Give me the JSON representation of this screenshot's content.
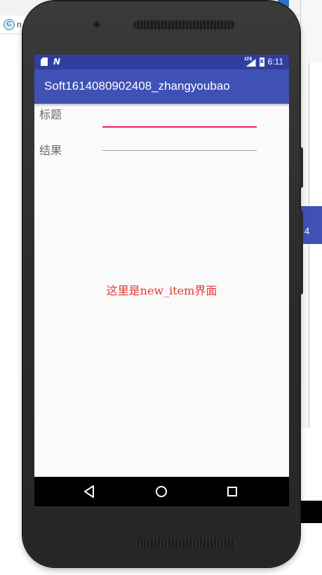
{
  "browser": {
    "tab_icon_letter": "C",
    "tab_text": "n"
  },
  "side_panel": {
    "partial_text": "4"
  },
  "status_bar": {
    "network_label": "N",
    "lte_label": "LTE",
    "battery_label": "x",
    "time": "6:11"
  },
  "app_bar": {
    "title": "Soft1614080902408_zhangyoubao"
  },
  "form": {
    "title_label": "标题",
    "title_value": "",
    "result_label": "结果",
    "result_value": ""
  },
  "main": {
    "center_text": "这里是new_item界面"
  },
  "colors": {
    "primary": "#3f51b5",
    "primary_dark": "#303f9f",
    "accent": "#e91e63",
    "center_text": "#e53935"
  },
  "icons": {
    "fab": "plus-icon",
    "nav_back": "back-triangle-icon",
    "nav_home": "home-circle-icon",
    "nav_recent": "recents-square-icon"
  }
}
